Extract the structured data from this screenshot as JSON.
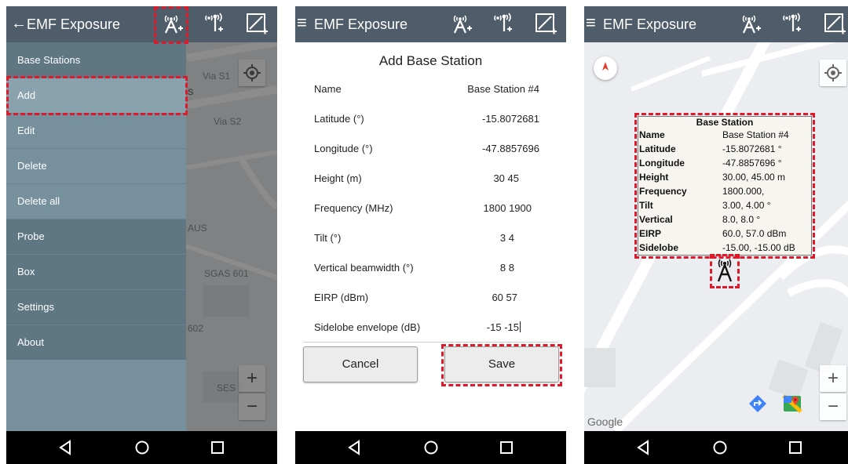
{
  "colors": {
    "appbar": "#4e5d69",
    "drawer": "#76909e",
    "highlight": "#e0192a",
    "map": "#e9ecee"
  },
  "phone1": {
    "appbar": {
      "back_glyph": "←",
      "title": "EMF Exposure",
      "icons": [
        "add-base-station-icon",
        "add-probe-icon",
        "add-box-icon"
      ]
    },
    "map_labels": {
      "via_s1": "Via S1",
      "via_s2": "Via S2",
      "s": "S",
      "aus": "AUS",
      "sgas": "SGAS 601",
      "n602": "602",
      "ses": "SES F"
    },
    "drawer": {
      "header": "Base Stations",
      "items": [
        {
          "label": "Add"
        },
        {
          "label": "Edit"
        },
        {
          "label": "Delete"
        },
        {
          "label": "Delete all"
        },
        {
          "label": "Probe"
        },
        {
          "label": "Box"
        },
        {
          "label": "Settings"
        },
        {
          "label": "About"
        }
      ]
    },
    "zoom": {
      "in": "+",
      "out": "−"
    }
  },
  "phone2": {
    "appbar": {
      "menu_glyph": "≡",
      "title": "EMF Exposure"
    },
    "form": {
      "title": "Add Base Station",
      "fields": [
        {
          "label": "Name",
          "value": "Base Station #4"
        },
        {
          "label": "Latitude (°)",
          "value": "-15.8072681"
        },
        {
          "label": "Longitude (°)",
          "value": "-47.8857696"
        },
        {
          "label": "Height (m)",
          "value": "30 45"
        },
        {
          "label": "Frequency (MHz)",
          "value": "1800 1900"
        },
        {
          "label": "Tilt (°)",
          "value": "3 4"
        },
        {
          "label": "Vertical beamwidth (°)",
          "value": "8 8"
        },
        {
          "label": "EIRP (dBm)",
          "value": "60 57"
        },
        {
          "label": "Sidelobe envelope (dB)",
          "value": "-15 -15"
        }
      ],
      "cancel_label": "Cancel",
      "save_label": "Save"
    }
  },
  "phone3": {
    "appbar": {
      "menu_glyph": "≡",
      "title": "EMF Exposure"
    },
    "info": {
      "title": "Base Station",
      "rows": [
        {
          "key": "Name",
          "value": "Base Station #4"
        },
        {
          "key": "Latitude",
          "value": "-15.8072681 °"
        },
        {
          "key": "Longitude",
          "value": "-47.8857696 °"
        },
        {
          "key": "Height",
          "value": "30.00, 45.00 m"
        },
        {
          "key": "Frequency",
          "value": "1800.000,"
        },
        {
          "key": "Tilt",
          "value": "3.00, 4.00 °"
        },
        {
          "key": "Vertical",
          "value": "8.0, 8.0 °"
        },
        {
          "key": "EIRP",
          "value": "60.0, 57.0 dBm"
        },
        {
          "key": "Sidelobe",
          "value": "-15.00, -15.00 dB"
        }
      ]
    },
    "google_label": "Google",
    "zoom": {
      "in": "+",
      "out": "−"
    }
  }
}
